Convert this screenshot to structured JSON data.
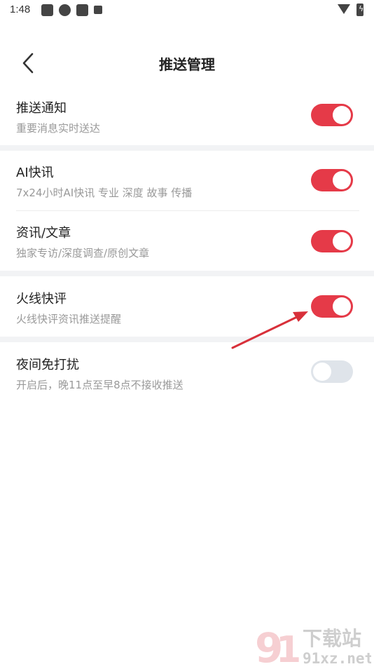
{
  "status_bar": {
    "time": "1:48"
  },
  "header": {
    "title": "推送管理"
  },
  "settings": [
    {
      "title": "推送通知",
      "subtitle": "重要消息实时送达",
      "enabled": true
    },
    {
      "title": "AI快讯",
      "subtitle": "7x24小时AI快讯 专业 深度 故事 传播",
      "enabled": true
    },
    {
      "title": "资讯/文章",
      "subtitle": "独家专访/深度调查/原创文章",
      "enabled": true
    },
    {
      "title": "火线快评",
      "subtitle": "火线快评资讯推送提醒",
      "enabled": true
    },
    {
      "title": "夜间免打扰",
      "subtitle": "开启后，晚11点至早8点不接收推送",
      "enabled": false
    }
  ],
  "colors": {
    "toggle_on": "#e53a48",
    "toggle_off": "#dfe4ea",
    "arrow": "#d8303a"
  },
  "watermark": {
    "text_top": "下载站",
    "text_bottom": "91xz.net"
  }
}
